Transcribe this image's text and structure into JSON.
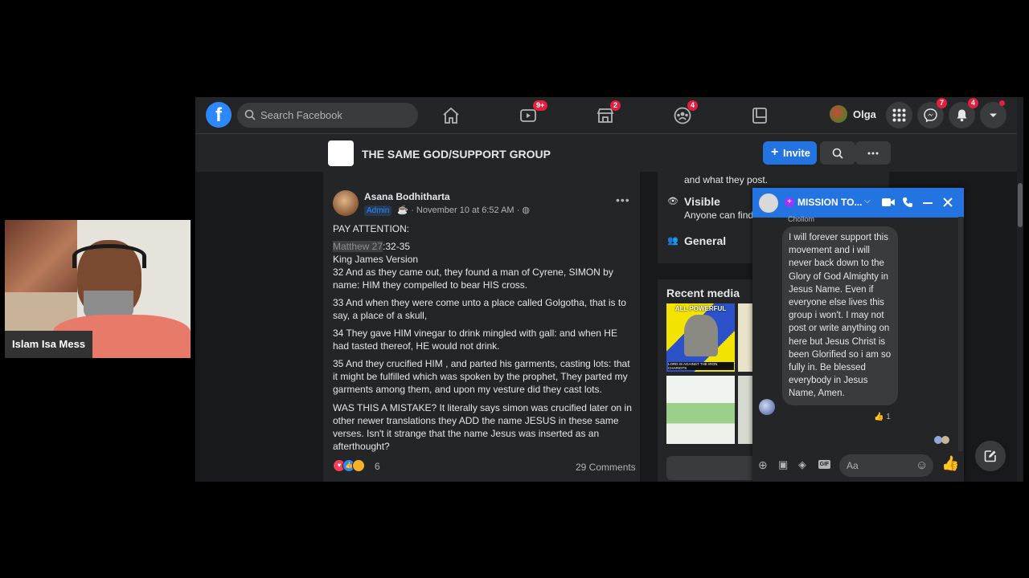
{
  "topbar": {
    "search_placeholder": "Search Facebook",
    "badges": {
      "watch": "9+",
      "marketplace": "2",
      "groups": "4",
      "messenger": "7",
      "notifications": "4"
    },
    "user_name": "Olga"
  },
  "group": {
    "title": "THE SAME GOD/SUPPORT GROUP",
    "invite_label": "Invite"
  },
  "post": {
    "author": "Asana Bodhitharta",
    "badge": "Admin",
    "meta": "· November 10 at 6:52 AM ·",
    "title_line": "PAY ATTENTION:",
    "ref_highlight": "Matthew 27",
    "ref_rest": ":32-35",
    "version": "King James Version",
    "v32": "32 And as they came out, they found a man of Cyrene, SIMON by name: HIM they compelled to bear HIS cross.",
    "v33": "33 And when they were come unto a place called Golgotha, that is to say, a place of a skull,",
    "v34": "34 They gave HIM vinegar to drink mingled with gall: and when HE had tasted thereof, HE would not drink.",
    "v35": "35 And they crucified HIM , and parted his garments, casting lots: that it might be fulfilled which was spoken by the prophet, They parted my garments among them, and upon my vesture did they cast lots.",
    "question": "WAS THIS A MISTAKE? It literally says simon was crucified later on in other newer translations they ADD the name JESUS in these same verses. Isn't it strange that the name Jesus was inserted as an afterthought?",
    "reaction_count": "6",
    "comments": "29 Comments"
  },
  "about": {
    "partial_text": "and what they post.",
    "visible_title": "Visible",
    "visible_desc": "Anyone can find",
    "general_title": "General"
  },
  "media": {
    "title": "Recent media",
    "thumb1_caption_top": "ALL POWERFUL",
    "thumb1_caption_bottom": "LORD IS AGAINST THE IRON CHARIOTS"
  },
  "chat": {
    "title": "MISSION TO...",
    "sender_partial": "Chollom",
    "message": "I will forever support this movement and i will never back down to the Glory of God Almighty in Jesus Name. Even if everyone else lives this group i won't. I may not post or write anything on here but Jesus Christ is been Glorified so i am so fully in. Be blessed everybody in Jesus Name, Amen.",
    "reaction": "1",
    "input_placeholder": "Aa"
  },
  "webcam": {
    "name": "Islam Isa Mess"
  },
  "colors": {
    "fb_blue": "#2d88ff",
    "button_blue": "#2374e1",
    "badge_red": "#e41e3f",
    "surface": "#242526",
    "background": "#18191a"
  }
}
